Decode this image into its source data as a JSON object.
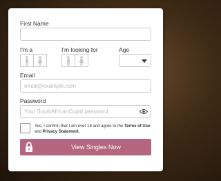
{
  "form": {
    "first_name_label": "First Name",
    "first_name_value": "",
    "im_a_label": "I'm a",
    "looking_for_label": "I'm looking for",
    "age_label": "Age",
    "age_value": "",
    "email_label": "Email",
    "email_placeholder": "email@example.com",
    "password_label": "Password",
    "password_placeholder": "Your SouthAfricanCupid password",
    "consent_prefix": "Yes, I confirm that I am over 18 and agree to the ",
    "terms_link": "Terms of Use",
    "consent_and": " and ",
    "privacy_link": "Privacy Statement",
    "consent_suffix": ".",
    "submit_label": "View Singles Now"
  },
  "icons": {
    "male": "male-icon",
    "female": "female-icon",
    "eye": "eye-icon",
    "lock": "lock-icon",
    "dropdown": "chevron-down-icon"
  },
  "colors": {
    "button": "#b5667f",
    "background": "#3d2a16"
  }
}
